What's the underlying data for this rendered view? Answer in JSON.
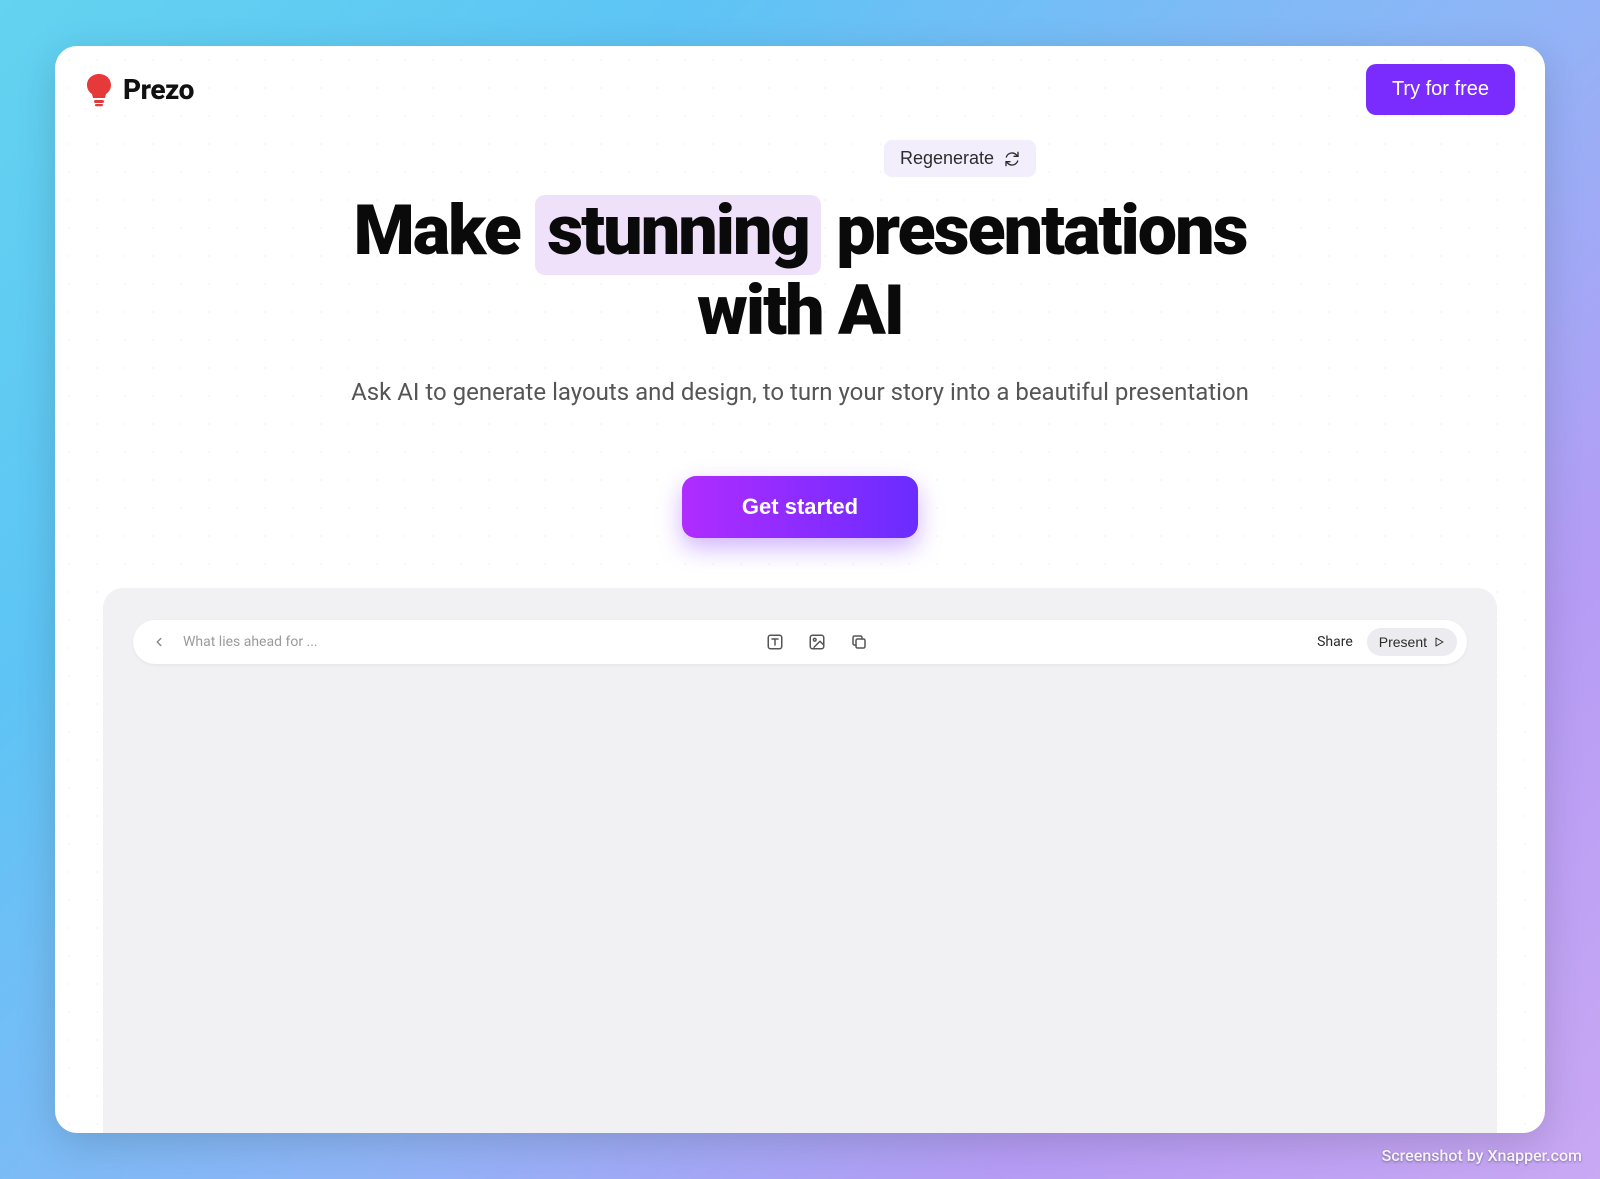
{
  "brand": {
    "name": "Prezo"
  },
  "header": {
    "try_label": "Try for free"
  },
  "hero": {
    "regenerate_label": "Regenerate",
    "headline_pre": "Make ",
    "headline_highlight": "stunning",
    "headline_post": " presentations with AI",
    "subheading": "Ask AI to generate layouts and design, to turn your story into a beautiful presentation",
    "cta_label": "Get started"
  },
  "preview": {
    "title_placeholder": "What lies ahead for ...",
    "share_label": "Share",
    "present_label": "Present",
    "icons": {
      "back": "chevron-left",
      "text": "text-style",
      "image": "image",
      "duplicate": "duplicate",
      "play": "play"
    }
  },
  "watermark": "Screenshot by Xnapper.com"
}
